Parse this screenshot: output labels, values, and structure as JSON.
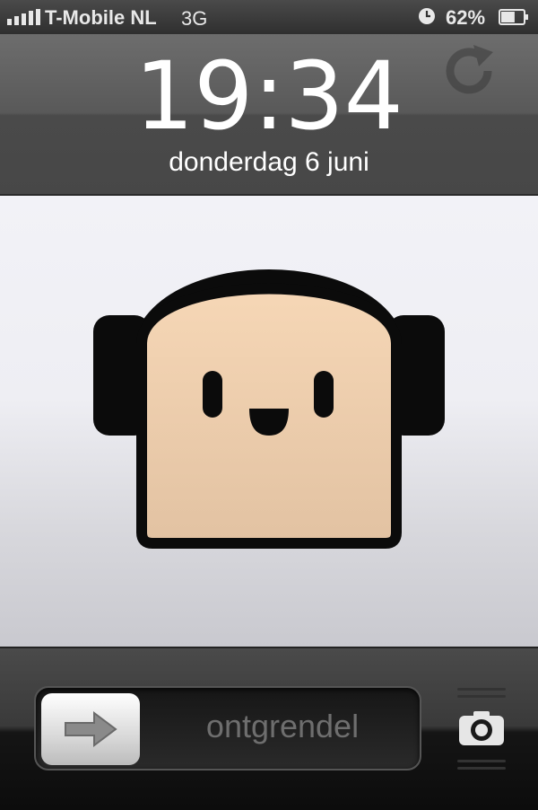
{
  "status_bar": {
    "carrier": "T-Mobile NL",
    "network": "3G",
    "battery_percent_label": "62%",
    "battery_level": 0.62,
    "icons": [
      "signal-icon",
      "clock-icon",
      "battery-icon"
    ]
  },
  "lock_screen": {
    "time": "19:34",
    "date": "donderdag 6 juni",
    "rotation_icon": "rotation-lock-icon"
  },
  "wallpaper": {
    "subject": "mascot-with-headphones-icon",
    "colors": {
      "face": "#f6d7b6",
      "outline": "#0b0b0b"
    }
  },
  "unlock_slider": {
    "label": "ontgrendel",
    "knob_icon": "arrow-right-icon"
  },
  "camera_shortcut": {
    "icon": "camera-icon"
  }
}
